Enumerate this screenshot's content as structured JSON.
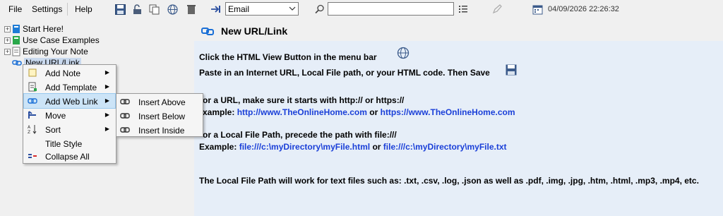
{
  "menubar": {
    "file": "File",
    "settings": "Settings",
    "help": "Help"
  },
  "toolbar": {
    "icons": [
      "save-icon",
      "unlock-icon",
      "copy-icon",
      "globe-icon",
      "trash-icon",
      "import-arrow-icon",
      "search-icon",
      "list-icon",
      "pencil-icon",
      "calendar-icon"
    ],
    "category_select": "Email",
    "search_value": "",
    "datetime": "04/09/2026 22:26:32"
  },
  "tree": {
    "items": [
      {
        "label": "Start Here!"
      },
      {
        "label": "Use Case Examples"
      },
      {
        "label": "Editing Your Note"
      },
      {
        "label": "New URL/Link"
      }
    ]
  },
  "context_menu": {
    "items": [
      {
        "label": "Add Note"
      },
      {
        "label": "Add Template"
      },
      {
        "label": "Add Web Link"
      },
      {
        "label": "Move"
      },
      {
        "label": "Sort"
      },
      {
        "label": "Title Style"
      },
      {
        "label": "Collapse All"
      }
    ],
    "submenu": [
      {
        "label": "Insert Above"
      },
      {
        "label": "Insert Below"
      },
      {
        "label": "Insert Inside"
      }
    ]
  },
  "note": {
    "title": "New URL/Link",
    "line1": "Click the HTML View Button in the menu bar",
    "line2": "Paste in an Internet URL, Local File path, or your HTML code. Then Save",
    "line3": "or a URL, make sure it starts with http:// or https://",
    "line4_prefix": "xample: ",
    "line4_link1": "http://www.TheOnlineHome.com",
    "line4_or": " or ",
    "line4_link2": "https://www.TheOnlineHome.com",
    "line5": "or a Local File Path, precede the path with file:///",
    "line6_prefix": "Example: ",
    "line6_link1": "file:///c:\\myDirectory\\myFile.html",
    "line6_or": " or ",
    "line6_link2": "file:///c:\\myDirectory\\myFile.txt",
    "line7": "The Local File Path will work for text files such as: .txt, .csv, .log, .json as well as .pdf, .img, .jpg, .htm, .html, .mp3, .mp4, etc."
  },
  "colors": {
    "link": "#1a3fd8",
    "content_bg": "#e6eef8",
    "highlight": "#cce4f7"
  }
}
